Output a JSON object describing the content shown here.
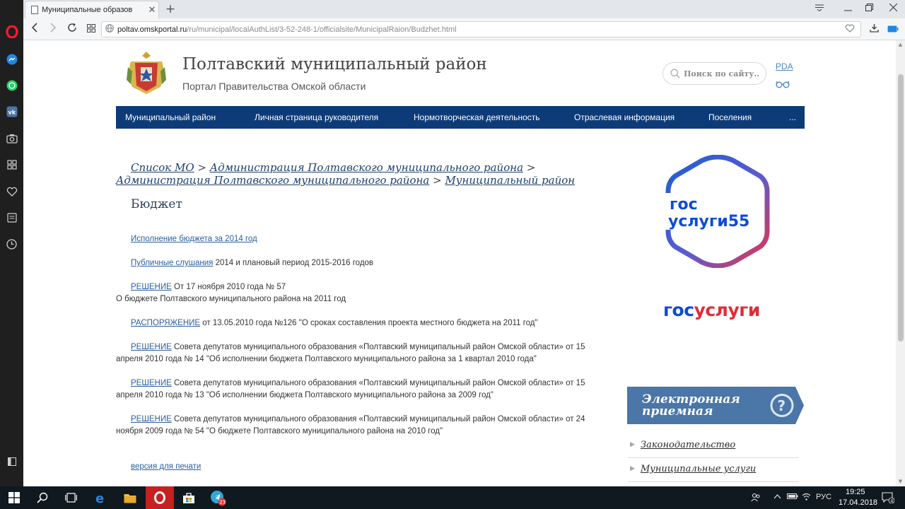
{
  "browser": {
    "tab_title": "Муниципальные образов",
    "new_tab_symbol": "+",
    "url_host": "poltav.omskportal.ru",
    "url_path": "/ru/municipal/localAuthList/3-52-248-1/officialsite/MunicipalRaion/Budzhet.html"
  },
  "header": {
    "title": "Полтавский муниципальный район",
    "subtitle": "Портал Правительства Омской области",
    "search_placeholder": "Поиск по сайту...",
    "pda_label": "PDA"
  },
  "menu": {
    "items": [
      "Муниципальный район",
      "Личная страница руководителя",
      "Нормотворческая деятельность",
      "Отраслевая информация",
      "Поселения",
      "..."
    ]
  },
  "breadcrumb": {
    "items": [
      "Список МО",
      "Администрация Полтавского муниципального района",
      "Администрация Полтавского муниципального района",
      "Муниципальный район"
    ],
    "separator": ">"
  },
  "page": {
    "heading": "Бюджет",
    "documents": [
      {
        "link": "Исполнение бюджета за 2014 год",
        "text": ""
      },
      {
        "link": "Публичные слушания",
        "text": " 2014 и плановый период 2015-2016 годов"
      },
      {
        "link": "РЕШЕНИЕ",
        "text": " От 17 ноября 2010 года № 57",
        "text2": "О бюджете Полтавского муниципального района на 2011 год"
      },
      {
        "link": "РАСПОРЯЖЕНИЕ",
        "text": " от 13.05.2010 года №126 \"О сроках составления проекта местного бюджета на 2011 год\""
      },
      {
        "link": "РЕШЕНИЕ",
        "text": " Совета депутатов муниципального образования «Полтавский муниципальный район Омской области» от 15 апреля 2010 года № 14 \"Об исполнении бюджета Полтавского муниципального района за 1 квартал 2010 года\""
      },
      {
        "link": "РЕШЕНИЕ",
        "text": " Совета депутатов муниципального образования «Полтавский муниципальный район Омской области» от 15 апреля 2010 года № 13 \"Об исполнении бюджета Полтавского муниципального района за 2009 год\""
      },
      {
        "link": "РЕШЕНИЕ",
        "text": " Совета депутатов муниципального образования «Полтавский муниципальный район Омской области» от 24 ноября 2009 года № 54 \"О бюджете Полтавского муниципального района на 2010 год\""
      }
    ],
    "print_link": "версия для печати"
  },
  "sidebar": {
    "gosuslugi55_line1": "гос",
    "gosuslugi55_line2": "услуги55",
    "gosuslugi_part1": "гос",
    "gosuslugi_part2": "услуги",
    "e_reception": "Электронная приемная",
    "links": [
      "Законодательство",
      "Муниципальные услуги"
    ]
  },
  "taskbar": {
    "telegram_badge": "23",
    "language": "РУС",
    "time": "19:25",
    "date": "17.04.2018",
    "notification_count": "4"
  },
  "colors": {
    "menu_bg": "#0d3b78",
    "link": "#2b5fa0",
    "gosuslugi_blue": "#0d4cd3",
    "gosuslugi_red": "#e12c38",
    "reception_bg": "#4a76a8"
  }
}
